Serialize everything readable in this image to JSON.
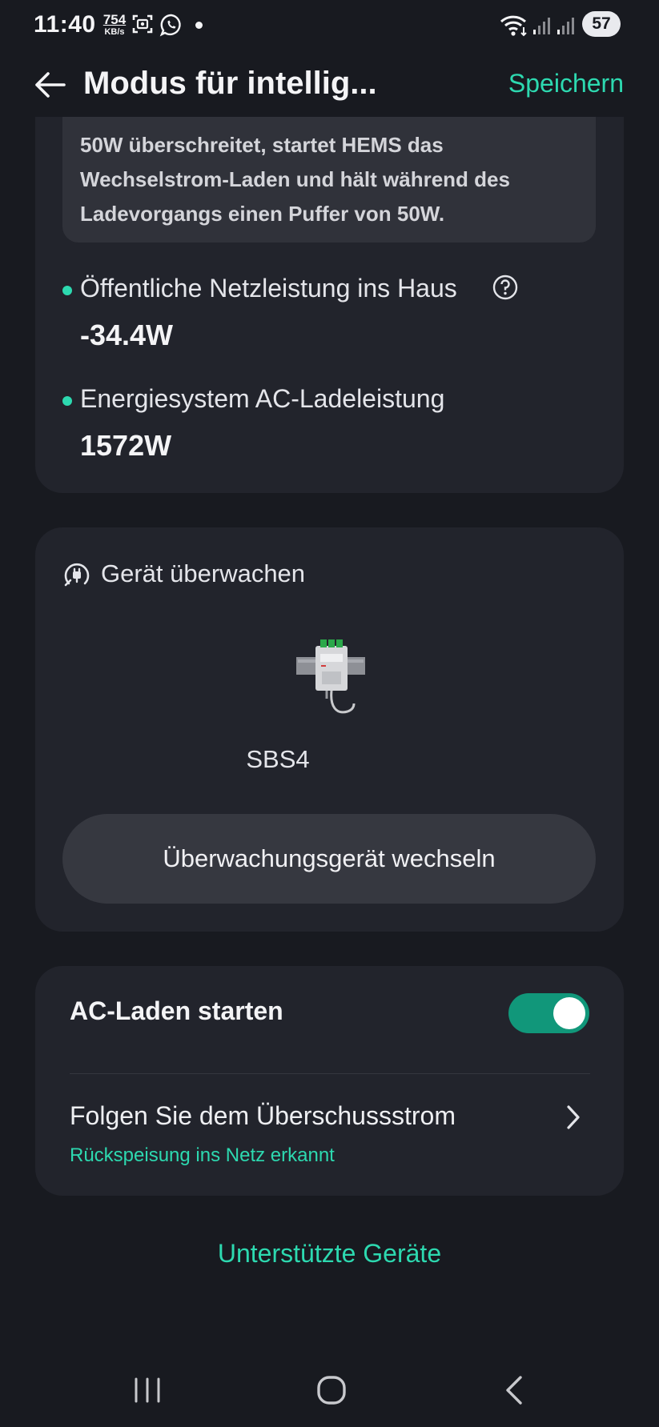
{
  "status_bar": {
    "time": "11:40",
    "net_speed": "754",
    "net_unit": "KB/s",
    "battery": "57",
    "icons": [
      "screenshot-icon",
      "whatsapp-icon",
      "notification-dot",
      "wifi-icon",
      "signal-icon",
      "signal-icon"
    ]
  },
  "header": {
    "back_icon": "back-arrow-icon",
    "title": "Modus für intellig...",
    "save_label": "Speichern"
  },
  "info_card": {
    "info_text": "50W überschreitet, startet HEMS das Wechselstrom-Laden und hält während des Ladevorgangs einen Puffer von 50W.",
    "grid_power": {
      "label": "Öffentliche Netzleistung ins Haus",
      "value": "-34.4W",
      "help_icon": "question-circle-icon"
    },
    "ac_charge_power": {
      "label": "Energiesystem AC-Ladeleistung",
      "value": "1572W"
    }
  },
  "monitor_card": {
    "title": "Gerät überwachen",
    "icon": "plug-monitor-icon",
    "device_name": "SBS4",
    "switch_button_label": "Überwachungsgerät wechseln"
  },
  "charge_card": {
    "ac_charge_label": "AC-Laden starten",
    "ac_charge_enabled": true,
    "follow_surplus_label": "Folgen Sie dem Überschussstrom",
    "follow_surplus_status": "Rückspeisung ins Netz erkannt"
  },
  "supported_devices_link": "Unterstützte Geräte",
  "colors": {
    "accent": "#2dd9b0",
    "toggle_on": "#11977a",
    "background": "#181a20",
    "card": "#22242c"
  },
  "nav_bar": {
    "icons": [
      "recent-apps-icon",
      "home-icon",
      "back-icon"
    ]
  }
}
